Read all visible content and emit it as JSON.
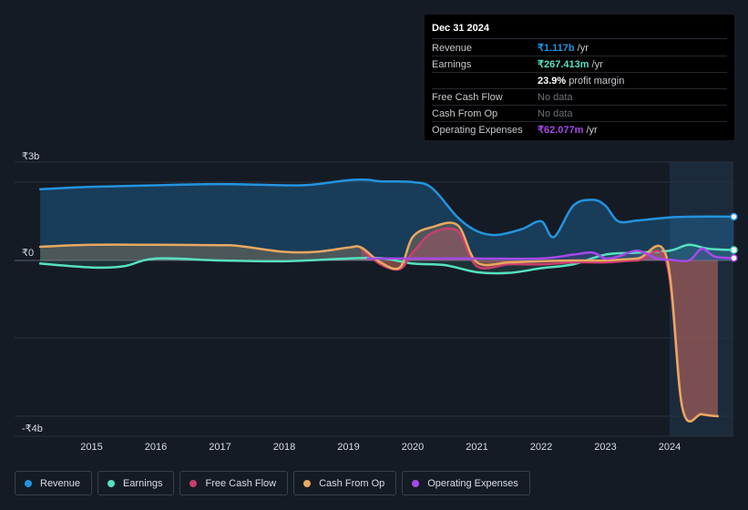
{
  "tooltip": {
    "date": "Dec 31 2024",
    "rows": [
      {
        "label": "Revenue",
        "value": "₹1.117b",
        "unit": "/yr",
        "color": "#2394df"
      },
      {
        "label": "Earnings",
        "value": "₹267.413m",
        "unit": "/yr",
        "color": "#58e0c0"
      },
      {
        "label": "",
        "value": "23.9%",
        "unit": "profit margin",
        "color": "#ffffff"
      },
      {
        "label": "Free Cash Flow",
        "value": "No data",
        "unit": "",
        "color": "#6b7178"
      },
      {
        "label": "Cash From Op",
        "value": "No data",
        "unit": "",
        "color": "#6b7178"
      },
      {
        "label": "Operating Expenses",
        "value": "₹62.077m",
        "unit": "/yr",
        "color": "#a649e8"
      }
    ]
  },
  "legend": [
    {
      "label": "Revenue",
      "color": "#2394df"
    },
    {
      "label": "Earnings",
      "color": "#58e0c0"
    },
    {
      "label": "Free Cash Flow",
      "color": "#c93e6f"
    },
    {
      "label": "Cash From Op",
      "color": "#e8a860"
    },
    {
      "label": "Operating Expenses",
      "color": "#a649e8"
    }
  ],
  "chart_data": {
    "type": "area",
    "title": "",
    "xlabel": "",
    "ylabel": "",
    "y_tick_labels": [
      "₹3b",
      "₹0",
      "-₹4b"
    ],
    "x_tick_labels": [
      "2015",
      "2016",
      "2017",
      "2018",
      "2019",
      "2020",
      "2021",
      "2022",
      "2023",
      "2024"
    ],
    "xlim": [
      2014.2,
      2025.0
    ],
    "ylim": [
      -4.0,
      2.5
    ],
    "units": "₹ billions",
    "highlight_from": 2024.0,
    "series": [
      {
        "name": "Revenue",
        "color": "#2394df",
        "x": [
          2014.2,
          2015.0,
          2016.0,
          2017.0,
          2018.0,
          2018.4,
          2019.0,
          2019.3,
          2019.5,
          2020.0,
          2020.3,
          2020.7,
          2021.0,
          2021.3,
          2021.7,
          2022.0,
          2022.2,
          2022.5,
          2022.8,
          2023.0,
          2023.2,
          2023.5,
          2024.0,
          2024.5,
          2025.0
        ],
        "values": [
          1.82,
          1.88,
          1.92,
          1.95,
          1.92,
          1.93,
          2.05,
          2.06,
          2.02,
          2.0,
          1.85,
          1.1,
          0.75,
          0.65,
          0.8,
          1.0,
          0.6,
          1.4,
          1.55,
          1.4,
          1.0,
          1.02,
          1.1,
          1.12,
          1.117
        ]
      },
      {
        "name": "Earnings",
        "color": "#58e0c0",
        "x": [
          2014.2,
          2015.0,
          2015.5,
          2016.0,
          2017.0,
          2018.0,
          2019.0,
          2019.5,
          2020.0,
          2020.5,
          2021.0,
          2021.5,
          2022.0,
          2022.5,
          2023.0,
          2023.5,
          2024.0,
          2024.3,
          2024.6,
          2025.0
        ],
        "values": [
          -0.08,
          -0.18,
          -0.15,
          0.05,
          0.0,
          -0.02,
          0.05,
          0.06,
          -0.08,
          -0.12,
          -0.3,
          -0.32,
          -0.2,
          -0.1,
          0.15,
          0.2,
          0.25,
          0.4,
          0.3,
          0.267
        ]
      },
      {
        "name": "Free Cash Flow",
        "color": "#c93e6f",
        "x": [
          2019.2,
          2019.5,
          2019.8,
          2020.0,
          2020.3,
          2020.7,
          2021.0,
          2021.5,
          2022.0,
          2022.5,
          2023.0,
          2023.5,
          2023.95,
          2024.2,
          2024.5,
          2024.75
        ],
        "values": [
          0.3,
          -0.1,
          -0.22,
          0.2,
          0.7,
          0.75,
          -0.15,
          -0.1,
          -0.1,
          -0.05,
          -0.05,
          0.0,
          -0.05,
          -3.8,
          -3.95,
          -4.0
        ]
      },
      {
        "name": "Cash From Op",
        "color": "#e8a860",
        "x": [
          2014.2,
          2015.0,
          2016.0,
          2017.0,
          2017.3,
          2018.0,
          2018.5,
          2019.0,
          2019.2,
          2019.5,
          2019.8,
          2020.0,
          2020.3,
          2020.7,
          2021.0,
          2021.5,
          2022.0,
          2022.5,
          2023.0,
          2023.5,
          2023.95,
          2024.2,
          2024.5,
          2024.75
        ],
        "values": [
          0.35,
          0.4,
          0.4,
          0.39,
          0.37,
          0.22,
          0.22,
          0.33,
          0.33,
          -0.05,
          -0.18,
          0.6,
          0.85,
          0.9,
          -0.05,
          -0.05,
          -0.02,
          0.0,
          0.0,
          0.05,
          0.1,
          -3.8,
          -3.95,
          -4.0
        ]
      },
      {
        "name": "Operating Expenses",
        "color": "#a649e8",
        "x": [
          2019.3,
          2020.0,
          2021.0,
          2022.0,
          2022.5,
          2022.8,
          2023.0,
          2023.2,
          2023.5,
          2023.8,
          2024.0,
          2024.3,
          2024.5,
          2024.7,
          2025.0
        ],
        "values": [
          0.05,
          0.05,
          0.05,
          0.05,
          0.15,
          0.2,
          0.05,
          0.1,
          0.25,
          0.05,
          0.02,
          0.0,
          0.3,
          0.1,
          0.062
        ]
      }
    ]
  }
}
